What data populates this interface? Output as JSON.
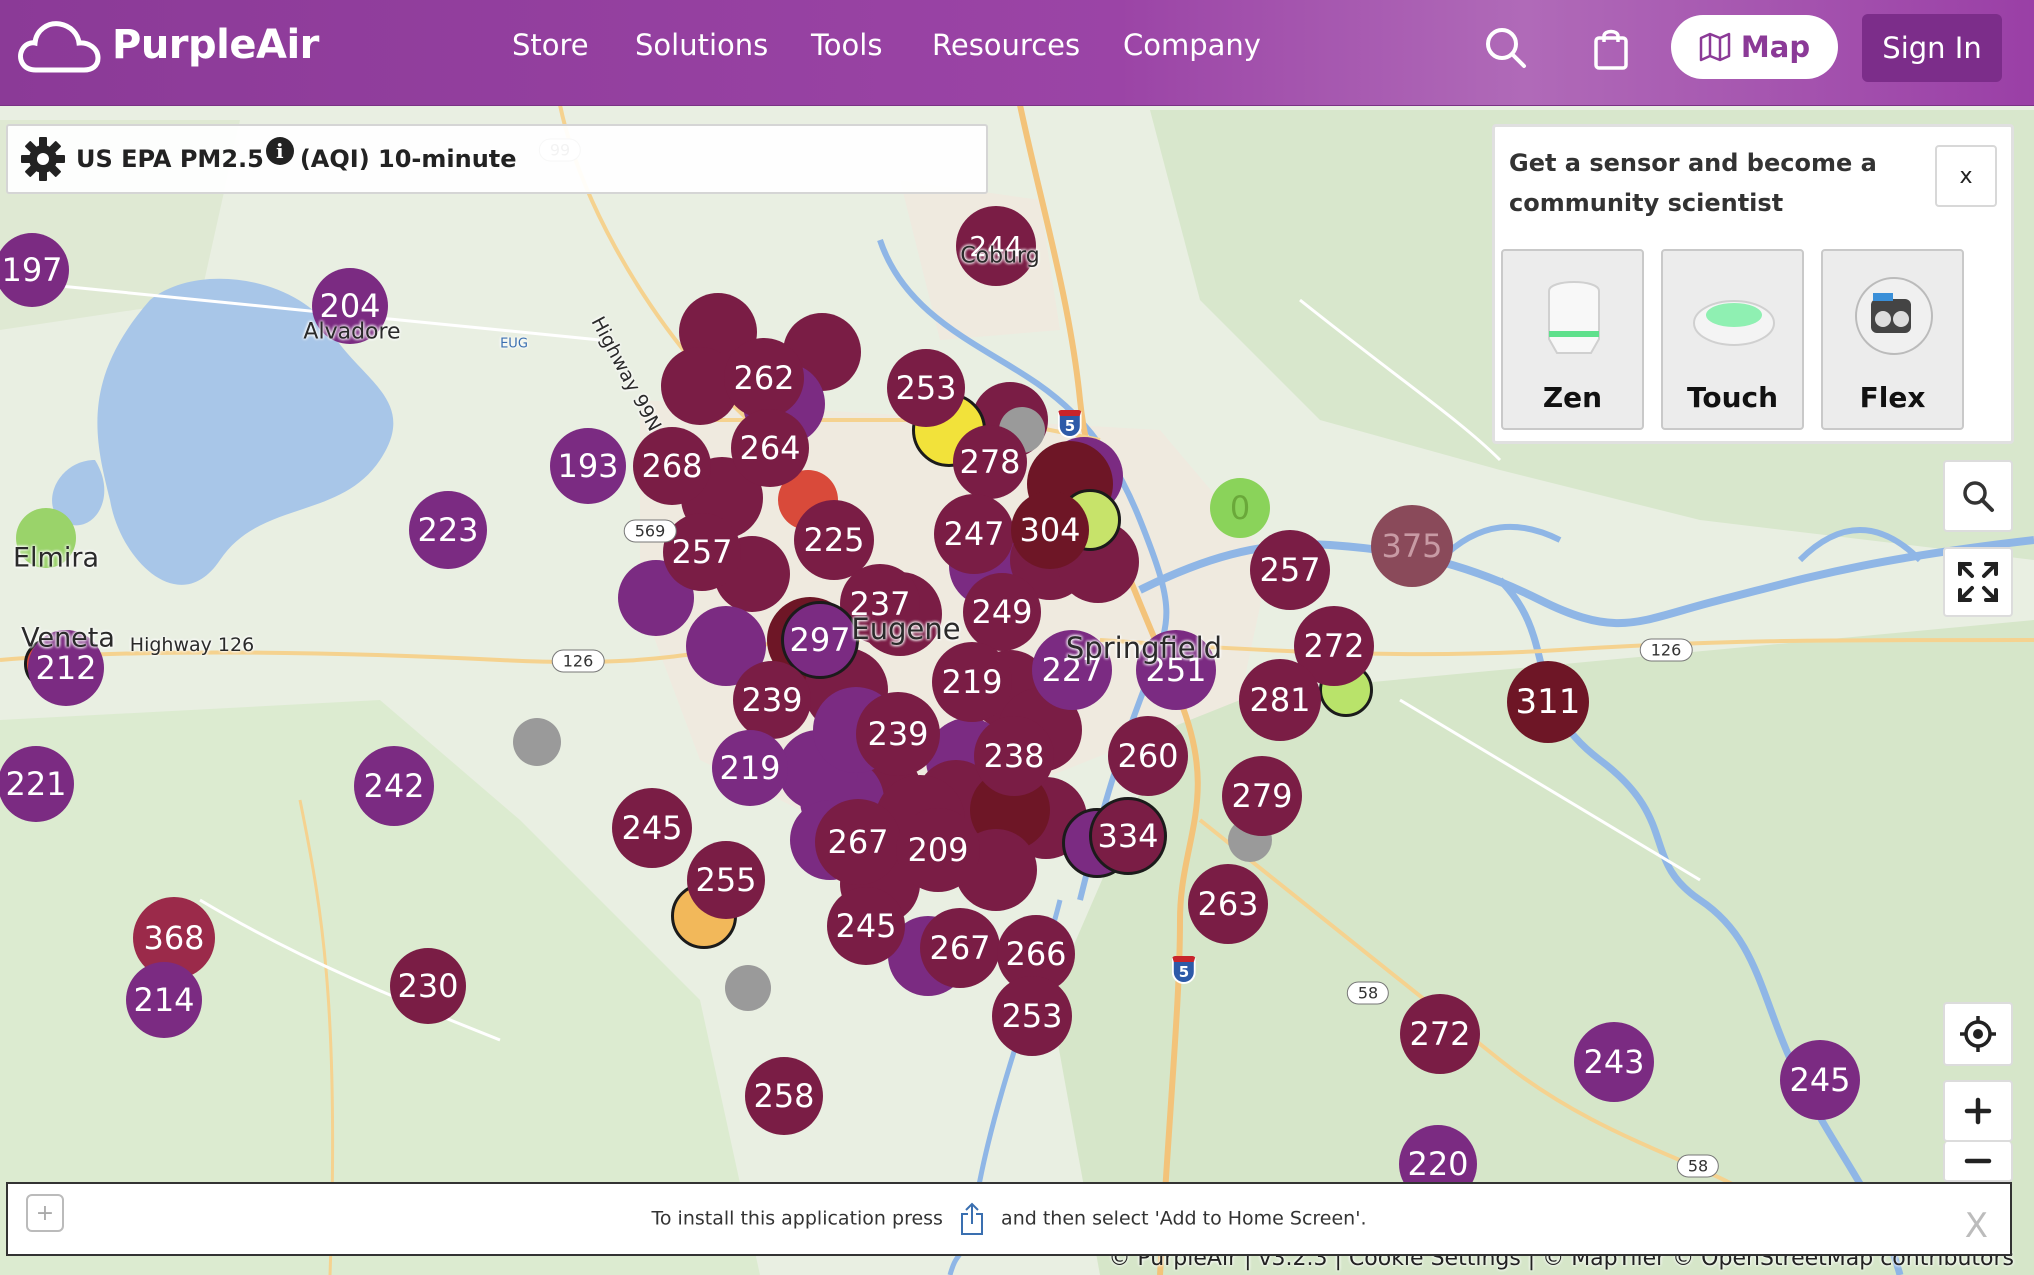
{
  "header": {
    "brand": "PurpleAir",
    "nav": [
      "Store",
      "Solutions",
      "Tools",
      "Resources",
      "Company"
    ],
    "map_label": "Map",
    "signin_label": "Sign In"
  },
  "settings": {
    "metric": "US EPA PM2.5",
    "average": "(AQI) 10-minute"
  },
  "promo": {
    "text": "Get a sensor and become a community scientist",
    "close": "x",
    "products": [
      "Zen",
      "Touch",
      "Flex"
    ]
  },
  "install": {
    "text_before": "To install this application press",
    "text_after": "and then select 'Add to Home Screen'.",
    "close": "X"
  },
  "attribution": "© PurpleAir | v3.2.3 | Cookie Settings | © MapTiler © OpenStreetMap contributors",
  "places": [
    {
      "name": "Alvadore"
    },
    {
      "name": "Elmira"
    },
    {
      "name": "Veneta"
    },
    {
      "name": "Highway 126"
    },
    {
      "name": "Highway 99N"
    },
    {
      "name": "Eugene"
    },
    {
      "name": "Springfield"
    },
    {
      "name": "Coburg"
    },
    {
      "name": "EUG"
    }
  ],
  "road_shields": [
    {
      "label": "569"
    },
    {
      "label": "126"
    },
    {
      "label": "126"
    },
    {
      "label": "58"
    },
    {
      "label": "58"
    },
    {
      "label": "99"
    }
  ],
  "interstate_shields": [
    "5",
    "5"
  ],
  "sensors": [
    {
      "v": "197"
    },
    {
      "v": "204"
    },
    {
      "v": "262"
    },
    {
      "v": "253"
    },
    {
      "v": "244"
    },
    {
      "v": "264"
    },
    {
      "v": "193"
    },
    {
      "v": "268"
    },
    {
      "v": "278"
    },
    {
      "v": "223"
    },
    {
      "v": "257"
    },
    {
      "v": "225"
    },
    {
      "v": "247"
    },
    {
      "v": "304"
    },
    {
      "v": "0"
    },
    {
      "v": "375"
    },
    {
      "v": "257"
    },
    {
      "v": "237"
    },
    {
      "v": "249"
    },
    {
      "v": "297"
    },
    {
      "v": "212"
    },
    {
      "v": "219"
    },
    {
      "v": "227"
    },
    {
      "v": "251"
    },
    {
      "v": "272"
    },
    {
      "v": "311"
    },
    {
      "v": "239"
    },
    {
      "v": "281"
    },
    {
      "v": "239"
    },
    {
      "v": "260"
    },
    {
      "v": "238"
    },
    {
      "v": "221"
    },
    {
      "v": "242"
    },
    {
      "v": "219"
    },
    {
      "v": "279"
    },
    {
      "v": "245"
    },
    {
      "v": "267"
    },
    {
      "v": "209"
    },
    {
      "v": "334"
    },
    {
      "v": "255"
    },
    {
      "v": "263"
    },
    {
      "v": "368"
    },
    {
      "v": "245"
    },
    {
      "v": "267"
    },
    {
      "v": "266"
    },
    {
      "v": "214"
    },
    {
      "v": "230"
    },
    {
      "v": "253"
    },
    {
      "v": "272"
    },
    {
      "v": "243"
    },
    {
      "v": "245"
    },
    {
      "v": "258"
    },
    {
      "v": "220"
    }
  ],
  "colors": {
    "brand": "#8b3a97",
    "sensor_purple": "#7b2b82",
    "sensor_maroon": "#7a1d45",
    "sensor_darkred": "#6e1626",
    "water": "#a8c6e8",
    "land": "#e9efe2"
  }
}
